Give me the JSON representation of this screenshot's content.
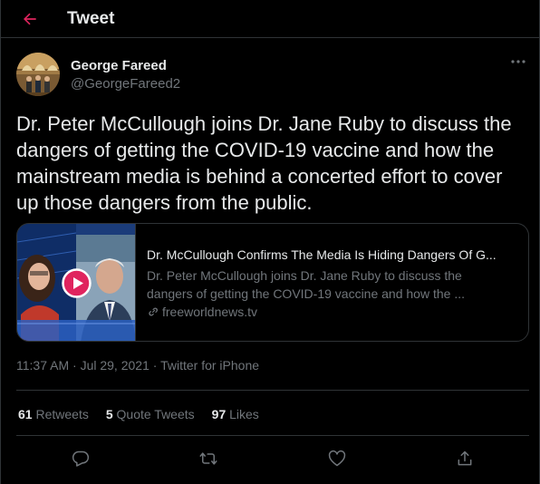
{
  "header": {
    "title": "Tweet",
    "back_icon": "arrow-left-icon",
    "accent": "#e0245e"
  },
  "author": {
    "display_name": "George Fareed",
    "handle": "@GeorgeFareed2",
    "more_icon": "more-horizontal-icon"
  },
  "tweet": {
    "text": "Dr. Peter McCullough joins Dr. Jane Ruby to discuss the dangers of getting the COVID-19 vaccine and how the mainstream media is behind a concerted effort to cover up those dangers from the public."
  },
  "card": {
    "title": "Dr. McCullough Confirms The Media Is Hiding Dangers Of G...",
    "description_line1": "Dr. Peter McCullough joins Dr. Jane Ruby to discuss the",
    "description_line2": "dangers of getting the COVID-19 vaccine and how the ...",
    "domain": "freeworldnews.tv",
    "play_color": "#e0245e"
  },
  "meta": {
    "time": "11:37 AM",
    "separator": "·",
    "date": "Jul 29, 2021",
    "source": "Twitter for iPhone"
  },
  "stats": {
    "retweets_count": "61",
    "retweets_label": "Retweets",
    "quotes_count": "5",
    "quotes_label": "Quote Tweets",
    "likes_count": "97",
    "likes_label": "Likes"
  },
  "actions": [
    "reply-icon",
    "retweet-icon",
    "like-icon",
    "share-icon"
  ]
}
